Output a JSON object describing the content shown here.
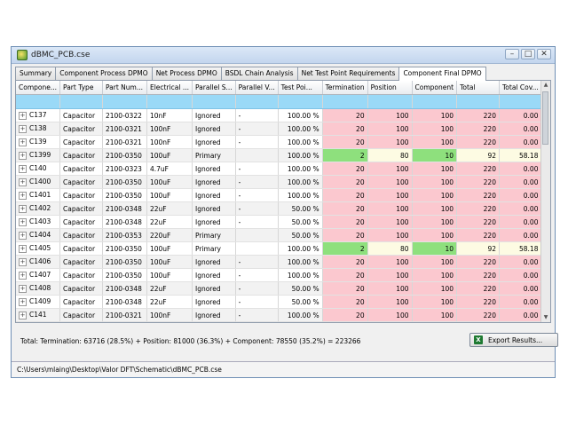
{
  "window": {
    "title": "dBMC_PCB.cse",
    "minimize": "–",
    "maximize": "□",
    "close": "✕"
  },
  "tabs": [
    {
      "label": "Summary"
    },
    {
      "label": "Component Process DPMO"
    },
    {
      "label": "Net Process DPMO"
    },
    {
      "label": "BSDL Chain Analysis"
    },
    {
      "label": "Net Test Point Requirements"
    },
    {
      "label": "Component Final DPMO"
    }
  ],
  "columns": [
    "Compone...",
    "Part Type",
    "Part Num...",
    "Electrical ...",
    "Parallel S...",
    "Parallel V...",
    "Test Poi...",
    "Termination",
    "Position",
    "Component",
    "Total",
    "Total Cov..."
  ],
  "rows": [
    {
      "ref": "C137",
      "type": "Capacitor",
      "pn": "2100-0322",
      "elec": "10nF",
      "ps": "Ignored",
      "pv": "-",
      "tp": "100.00 %",
      "term": "20",
      "pos": "100",
      "comp": "100",
      "total": "220",
      "cov": "0.00 %",
      "hl": false
    },
    {
      "ref": "C138",
      "type": "Capacitor",
      "pn": "2100-0321",
      "elec": "100nF",
      "ps": "Ignored",
      "pv": "-",
      "tp": "100.00 %",
      "term": "20",
      "pos": "100",
      "comp": "100",
      "total": "220",
      "cov": "0.00 %",
      "hl": false
    },
    {
      "ref": "C139",
      "type": "Capacitor",
      "pn": "2100-0321",
      "elec": "100nF",
      "ps": "Ignored",
      "pv": "-",
      "tp": "100.00 %",
      "term": "20",
      "pos": "100",
      "comp": "100",
      "total": "220",
      "cov": "0.00 %",
      "hl": false
    },
    {
      "ref": "C1399",
      "type": "Capacitor",
      "pn": "2100-0350",
      "elec": "100uF",
      "ps": "Primary",
      "pv": "",
      "tp": "100.00 %",
      "term": "2",
      "pos": "80",
      "comp": "10",
      "total": "92",
      "cov": "58.18 %",
      "hl": true
    },
    {
      "ref": "C140",
      "type": "Capacitor",
      "pn": "2100-0323",
      "elec": "4.7uF",
      "ps": "Ignored",
      "pv": "-",
      "tp": "100.00 %",
      "term": "20",
      "pos": "100",
      "comp": "100",
      "total": "220",
      "cov": "0.00 %",
      "hl": false
    },
    {
      "ref": "C1400",
      "type": "Capacitor",
      "pn": "2100-0350",
      "elec": "100uF",
      "ps": "Ignored",
      "pv": "-",
      "tp": "100.00 %",
      "term": "20",
      "pos": "100",
      "comp": "100",
      "total": "220",
      "cov": "0.00 %",
      "hl": false
    },
    {
      "ref": "C1401",
      "type": "Capacitor",
      "pn": "2100-0350",
      "elec": "100uF",
      "ps": "Ignored",
      "pv": "-",
      "tp": "100.00 %",
      "term": "20",
      "pos": "100",
      "comp": "100",
      "total": "220",
      "cov": "0.00 %",
      "hl": false
    },
    {
      "ref": "C1402",
      "type": "Capacitor",
      "pn": "2100-0348",
      "elec": "22uF",
      "ps": "Ignored",
      "pv": "-",
      "tp": "50.00 %",
      "term": "20",
      "pos": "100",
      "comp": "100",
      "total": "220",
      "cov": "0.00 %",
      "hl": false
    },
    {
      "ref": "C1403",
      "type": "Capacitor",
      "pn": "2100-0348",
      "elec": "22uF",
      "ps": "Ignored",
      "pv": "-",
      "tp": "50.00 %",
      "term": "20",
      "pos": "100",
      "comp": "100",
      "total": "220",
      "cov": "0.00 %",
      "hl": false
    },
    {
      "ref": "C1404",
      "type": "Capacitor",
      "pn": "2100-0353",
      "elec": "220uF",
      "ps": "Primary",
      "pv": "",
      "tp": "50.00 %",
      "term": "20",
      "pos": "100",
      "comp": "100",
      "total": "220",
      "cov": "0.00 %",
      "hl": false
    },
    {
      "ref": "C1405",
      "type": "Capacitor",
      "pn": "2100-0350",
      "elec": "100uF",
      "ps": "Primary",
      "pv": "",
      "tp": "100.00 %",
      "term": "2",
      "pos": "80",
      "comp": "10",
      "total": "92",
      "cov": "58.18 %",
      "hl": true
    },
    {
      "ref": "C1406",
      "type": "Capacitor",
      "pn": "2100-0350",
      "elec": "100uF",
      "ps": "Ignored",
      "pv": "-",
      "tp": "100.00 %",
      "term": "20",
      "pos": "100",
      "comp": "100",
      "total": "220",
      "cov": "0.00 %",
      "hl": false
    },
    {
      "ref": "C1407",
      "type": "Capacitor",
      "pn": "2100-0350",
      "elec": "100uF",
      "ps": "Ignored",
      "pv": "-",
      "tp": "100.00 %",
      "term": "20",
      "pos": "100",
      "comp": "100",
      "total": "220",
      "cov": "0.00 %",
      "hl": false
    },
    {
      "ref": "C1408",
      "type": "Capacitor",
      "pn": "2100-0348",
      "elec": "22uF",
      "ps": "Ignored",
      "pv": "-",
      "tp": "50.00 %",
      "term": "20",
      "pos": "100",
      "comp": "100",
      "total": "220",
      "cov": "0.00 %",
      "hl": false
    },
    {
      "ref": "C1409",
      "type": "Capacitor",
      "pn": "2100-0348",
      "elec": "22uF",
      "ps": "Ignored",
      "pv": "-",
      "tp": "50.00 %",
      "term": "20",
      "pos": "100",
      "comp": "100",
      "total": "220",
      "cov": "0.00 %",
      "hl": false
    },
    {
      "ref": "C141",
      "type": "Capacitor",
      "pn": "2100-0321",
      "elec": "100nF",
      "ps": "Ignored",
      "pv": "-",
      "tp": "100.00 %",
      "term": "20",
      "pos": "100",
      "comp": "100",
      "total": "220",
      "cov": "0.00 %",
      "hl": false
    }
  ],
  "total_line": "Total:  Termination: 63716 (28.5%) + Position: 81000 (36.3%) + Component: 78550 (35.2%)  = 223266",
  "export_button": "Export Results...",
  "status_path": "C:\\Users\\mlaing\\Desktop\\Valor DFT\\Schematic\\dBMC_PCB.cse",
  "colors": {
    "low_coverage": "#fbc8cf",
    "good_coverage": "#8ee07d",
    "filter_row": "#9ad9f7"
  }
}
